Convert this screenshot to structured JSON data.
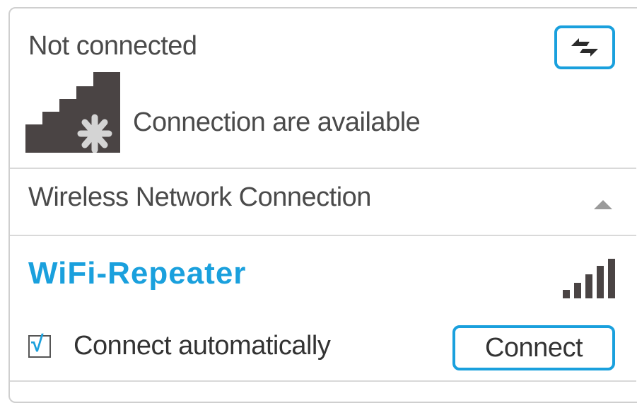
{
  "status": {
    "title": "Not connected",
    "subtitle": "Connection are available",
    "network_icon": "network-staircase-icon",
    "refresh_icon": "refresh-arrows-icon"
  },
  "section": {
    "title": "Wireless Network Connection",
    "toggle_icon": "collapse-arrow-icon"
  },
  "network": {
    "name": "WiFi-Repeater",
    "signal_icon": "signal-strength-icon",
    "signal_bars": 5,
    "auto_connect_label": "Connect automatically",
    "auto_connect_checked": true,
    "connect_label": "Connect"
  },
  "colors": {
    "accent": "#1aa0dd",
    "text": "#4a4a4a",
    "icon_dark": "#4a4444",
    "divider": "#d9d9d9"
  }
}
